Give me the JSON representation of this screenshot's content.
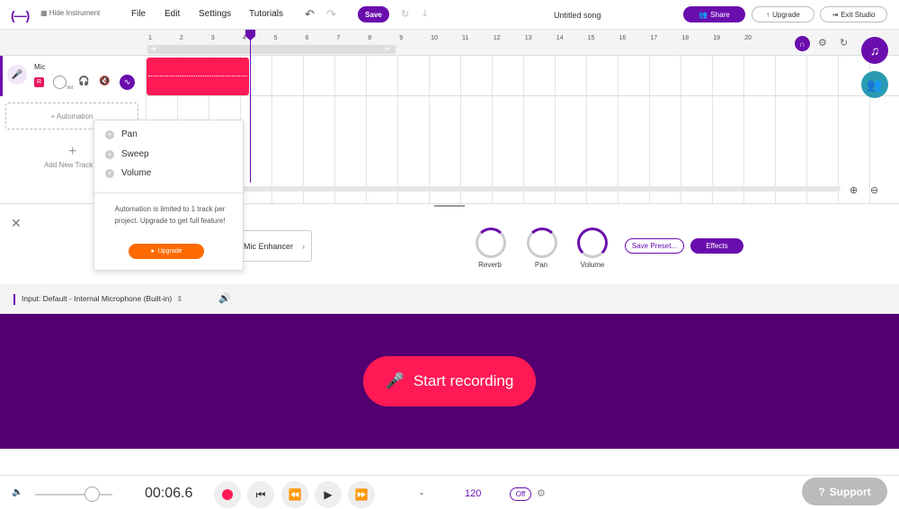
{
  "topbar": {
    "logo": "(—)",
    "menu": [
      "File",
      "Edit",
      "Settings",
      "Tutorials"
    ],
    "save_label": "Save",
    "song_title": "Untitled song",
    "share_label": "Share",
    "upgrade_label": "Upgrade",
    "exit_label": "Exit Studio"
  },
  "tracks": {
    "hide_instrument_label": "Hide Instrument",
    "track_name": "Mic",
    "record_badge": "R",
    "vol_label": "Vol",
    "automation_label": "+ Automation",
    "add_new_track_label": "Add New Track"
  },
  "ruler": {
    "ticks": [
      "1",
      "2",
      "3",
      "4",
      "5",
      "6",
      "7",
      "8",
      "9",
      "10",
      "11",
      "12",
      "13",
      "14",
      "15",
      "16",
      "17",
      "18",
      "19",
      "20"
    ]
  },
  "automation_popup": {
    "items": [
      "Pan",
      "Sweep",
      "Volume"
    ],
    "message": "Automation is limited to 1 track per project. Upgrade to get full feature!",
    "upgrade_label": "Upgrade"
  },
  "instrument_panel": {
    "preset_name": "Mic Enhancer",
    "knobs": [
      "Reverb",
      "Pan",
      "Volume"
    ],
    "save_preset_label": "Save Preset...",
    "effects_label": "Effects",
    "input_label": "Input: Default - Internal Microphone (Built-in)"
  },
  "recording": {
    "start_label": "Start recording"
  },
  "transport": {
    "time": "00:06.6",
    "key": "-",
    "tempo": "120",
    "metronome": "Off",
    "support_label": "Support"
  },
  "colors": {
    "accent": "#6a0dad",
    "record": "#ff1a55",
    "record_area": "#520070"
  }
}
